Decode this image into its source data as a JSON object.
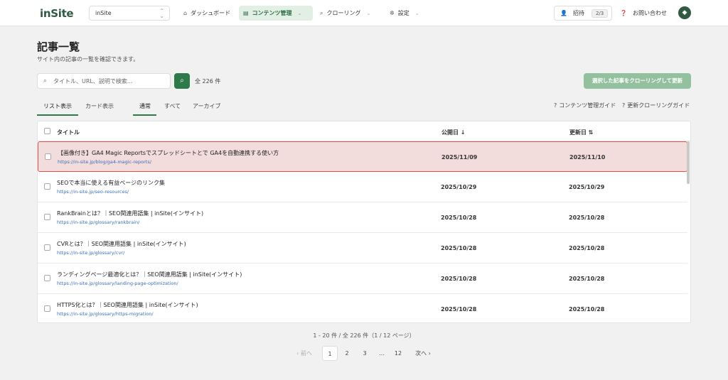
{
  "header": {
    "logo": "inSite",
    "site_select": "inSite",
    "nav": [
      {
        "label": "ダッシュボード",
        "icon": "home-icon"
      },
      {
        "label": "コンテンツ管理",
        "icon": "document-icon"
      },
      {
        "label": "クローリング",
        "icon": "search-icon"
      },
      {
        "label": "設定",
        "icon": "gear-icon"
      }
    ],
    "invite_label": "招待",
    "invite_count": "2/3",
    "contact_label": "お問い合わせ"
  },
  "page": {
    "title": "記事一覧",
    "description": "サイト内の記事の一覧を確認できます。",
    "search_placeholder": "タイトル、URL、説明で検索...",
    "total": "全 226 件",
    "crawl_button": "選択した記事をクローリングして更新"
  },
  "view_tabs": [
    "リスト表示",
    "カード表示"
  ],
  "filter_tabs": [
    "通常",
    "すべて",
    "アーカイブ"
  ],
  "guides": [
    "コンテンツ管理ガイド",
    "更新クローリングガイド"
  ],
  "table": {
    "columns": {
      "title": "タイトル",
      "published": "公開日 ↓",
      "updated": "更新日 ⇅"
    },
    "rows": [
      {
        "title": "【画像付き】GA4 Magic Reportsでスプレッドシートとで GA4を自動連携する使い方",
        "url": "https://in-site.jp/blog/ga4-magic-reports/",
        "published": "2025/11/09",
        "updated": "2025/11/10"
      },
      {
        "title": "SEOで本当に使える有益ページのリンク集",
        "url": "https://in-site.jp/seo-resources/",
        "published": "2025/10/29",
        "updated": "2025/10/29"
      },
      {
        "title": "RankBrainとは？｜SEO関連用語集 | inSite(インサイト)",
        "url": "https://in-site.jp/glossary/rankbrain/",
        "published": "2025/10/28",
        "updated": "2025/10/28"
      },
      {
        "title": "CVRとは？｜SEO関連用語集 | inSite(インサイト)",
        "url": "https://in-site.jp/glossary/cvr/",
        "published": "2025/10/28",
        "updated": "2025/10/28"
      },
      {
        "title": "ランディングページ最適化とは？｜SEO関連用語集 | inSite(インサイト)",
        "url": "https://in-site.jp/glossary/landing-page-optimization/",
        "published": "2025/10/28",
        "updated": "2025/10/28"
      },
      {
        "title": "HTTPS化とは？｜SEO関連用語集 | inSite(インサイト)",
        "url": "https://in-site.jp/glossary/https-migration/",
        "published": "2025/10/28",
        "updated": "2025/10/28"
      }
    ]
  },
  "pagination": {
    "info": "1 - 20 件 / 全 226 件（1 / 12 ページ）",
    "prev": "‹ 前へ",
    "pages": [
      "1",
      "2",
      "3",
      "…",
      "12"
    ],
    "next": "次へ ›"
  }
}
